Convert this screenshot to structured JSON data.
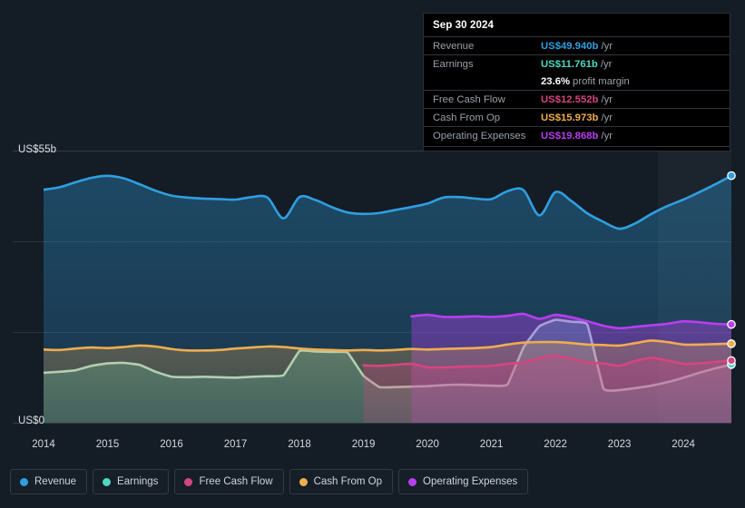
{
  "axis": {
    "y_top_label": "US$55b",
    "y_bottom_label": "US$0",
    "x_ticks": [
      "2014",
      "2015",
      "2016",
      "2017",
      "2018",
      "2019",
      "2020",
      "2021",
      "2022",
      "2023",
      "2024"
    ]
  },
  "tooltip": {
    "date": "Sep 30 2024",
    "rows": [
      {
        "label": "Revenue",
        "value": "US$49.940b",
        "suffix": "/yr",
        "color": "#2f9fe0"
      },
      {
        "label": "Earnings",
        "value": "US$11.761b",
        "suffix": "/yr",
        "color": "#4fd8c0"
      },
      {
        "label": "",
        "value": "23.6%",
        "suffix": "profit margin",
        "color": "#ffffff"
      },
      {
        "label": "Free Cash Flow",
        "value": "US$12.552b",
        "suffix": "/yr",
        "color": "#d6457f"
      },
      {
        "label": "Cash From Op",
        "value": "US$15.973b",
        "suffix": "/yr",
        "color": "#f0ad4e"
      },
      {
        "label": "Operating Expenses",
        "value": "US$19.868b",
        "suffix": "/yr",
        "color": "#b83ef0"
      }
    ]
  },
  "legend": [
    {
      "label": "Revenue",
      "color": "#2f9fe0"
    },
    {
      "label": "Earnings",
      "color": "#4fd8c0"
    },
    {
      "label": "Free Cash Flow",
      "color": "#d6457f"
    },
    {
      "label": "Cash From Op",
      "color": "#f0ad4e"
    },
    {
      "label": "Operating Expenses",
      "color": "#b83ef0"
    }
  ],
  "chart_data": {
    "type": "area",
    "title": "",
    "xlabel": "",
    "ylabel": "US$",
    "ylim": [
      0,
      55
    ],
    "grid": true,
    "legend_position": "bottom",
    "units": "US$ billions per year",
    "x": [
      2014.0,
      2014.25,
      2014.5,
      2014.75,
      2015.0,
      2015.25,
      2015.5,
      2015.75,
      2016.0,
      2016.25,
      2016.5,
      2016.75,
      2017.0,
      2017.25,
      2017.5,
      2017.75,
      2018.0,
      2018.25,
      2018.5,
      2018.75,
      2019.0,
      2019.25,
      2019.5,
      2019.75,
      2020.0,
      2020.25,
      2020.5,
      2020.75,
      2021.0,
      2021.25,
      2021.5,
      2021.75,
      2022.0,
      2022.25,
      2022.5,
      2022.75,
      2023.0,
      2023.25,
      2023.5,
      2023.75,
      2024.0,
      2024.25,
      2024.5,
      2024.75
    ],
    "forecast_start_x": 2023.6,
    "series": [
      {
        "name": "Revenue",
        "color": "#2f9fe0",
        "values": [
          47.1,
          47.6,
          48.6,
          49.5,
          49.9,
          49.4,
          48.2,
          46.9,
          45.9,
          45.5,
          45.3,
          45.2,
          45.1,
          45.6,
          45.5,
          41.3,
          45.6,
          45.0,
          43.6,
          42.5,
          42.2,
          42.4,
          43.0,
          43.6,
          44.3,
          45.5,
          45.6,
          45.3,
          45.2,
          46.8,
          47.0,
          41.9,
          46.6,
          44.8,
          42.3,
          40.6,
          39.2,
          40.3,
          42.2,
          43.8,
          45.1,
          46.6,
          48.2,
          49.94
        ]
      },
      {
        "name": "Earnings",
        "color": "#4fd8c0",
        "values": [
          10.1,
          10.3,
          10.6,
          11.5,
          12.0,
          12.1,
          11.7,
          10.3,
          9.3,
          9.2,
          9.3,
          9.2,
          9.1,
          9.3,
          9.4,
          9.6,
          14.5,
          14.4,
          14.3,
          14.2,
          9.5,
          7.2,
          7.2,
          7.3,
          7.4,
          7.6,
          7.7,
          7.6,
          7.5,
          7.7,
          15.2,
          19.5,
          20.8,
          20.4,
          19.8,
          6.9,
          6.6,
          7.0,
          7.5,
          8.2,
          9.1,
          10.1,
          11.0,
          11.761
        ]
      },
      {
        "name": "Free Cash Flow",
        "color": "#d6457f",
        "values": [
          null,
          null,
          null,
          null,
          null,
          null,
          null,
          null,
          null,
          null,
          null,
          null,
          null,
          null,
          null,
          null,
          null,
          null,
          null,
          null,
          11.6,
          11.5,
          11.7,
          11.9,
          11.2,
          11.2,
          11.3,
          11.4,
          11.5,
          11.9,
          12.2,
          13.1,
          13.5,
          13.0,
          12.2,
          12.0,
          11.5,
          12.5,
          13.1,
          12.6,
          11.9,
          12.0,
          12.3,
          12.552
        ]
      },
      {
        "name": "Cash From Op",
        "color": "#f0ad4e",
        "values": [
          14.8,
          14.7,
          15.0,
          15.2,
          15.1,
          15.3,
          15.6,
          15.4,
          14.9,
          14.6,
          14.6,
          14.7,
          15.0,
          15.2,
          15.4,
          15.3,
          15.0,
          14.8,
          14.7,
          14.6,
          14.7,
          14.6,
          14.7,
          14.9,
          14.8,
          14.9,
          15.0,
          15.1,
          15.3,
          15.8,
          16.2,
          16.3,
          16.3,
          16.1,
          15.8,
          15.7,
          15.6,
          16.1,
          16.6,
          16.3,
          15.8,
          15.8,
          15.9,
          15.973
        ]
      },
      {
        "name": "Operating Expenses",
        "color": "#b83ef0",
        "values": [
          null,
          null,
          null,
          null,
          null,
          null,
          null,
          null,
          null,
          null,
          null,
          null,
          null,
          null,
          null,
          null,
          null,
          null,
          null,
          null,
          null,
          null,
          null,
          21.5,
          21.8,
          21.4,
          21.4,
          21.5,
          21.4,
          21.6,
          22.0,
          21.0,
          21.8,
          21.3,
          20.5,
          19.6,
          19.1,
          19.4,
          19.7,
          20.0,
          20.5,
          20.3,
          20.0,
          19.868
        ]
      }
    ]
  }
}
